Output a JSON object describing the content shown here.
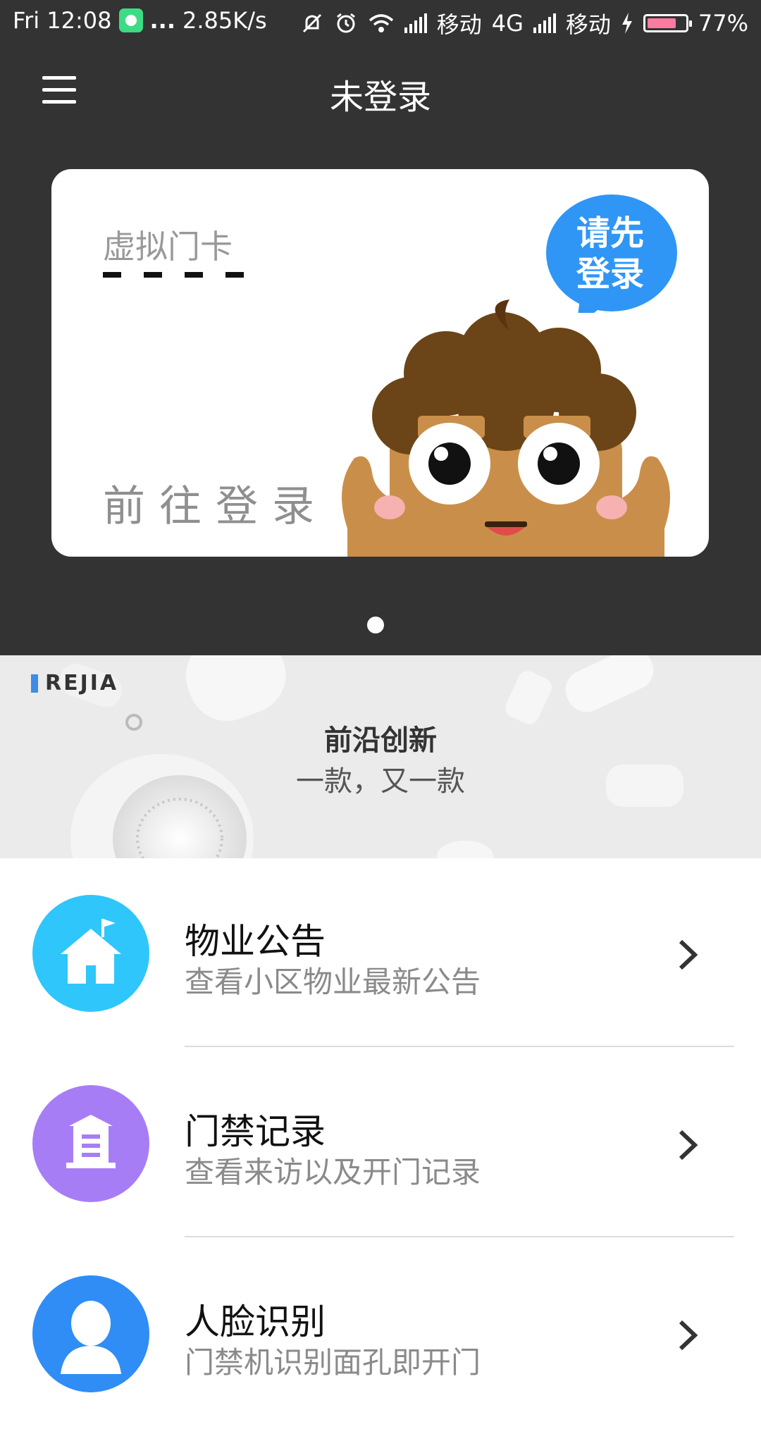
{
  "status_bar": {
    "day_time": "Fri 12:08",
    "dots": "...",
    "net_speed": "2.85K/s",
    "carrier1": "移动",
    "net_type": "4G",
    "carrier2": "移动",
    "battery": "77%",
    "battery_level": 0.77,
    "battery_color": "#ff7aa0"
  },
  "header": {
    "title": "未登录",
    "menu_icon": "hamburger-icon",
    "background": "#333333"
  },
  "card": {
    "label": "虚拟门卡",
    "masked_number": "– – – –",
    "bubble_text_line1": "请先",
    "bubble_text_line2": "登录",
    "login_link": "前往登录",
    "bubble_color": "#2f96f5",
    "carousel_page": "1/1"
  },
  "banner": {
    "brand": "REJIA",
    "title": "前沿创新",
    "subtitle": "一款，又一款"
  },
  "menu": [
    {
      "title": "物业公告",
      "desc": "查看小区物业最新公告",
      "icon": "house-flag-icon",
      "color": "#2ec6fb"
    },
    {
      "title": "门禁记录",
      "desc": "查看来访以及开门记录",
      "icon": "gate-building-icon",
      "color": "#a77df6"
    },
    {
      "title": "人脸识别",
      "desc": "门禁机识别面孔即开门",
      "icon": "person-icon",
      "color": "#2f8df5"
    }
  ]
}
